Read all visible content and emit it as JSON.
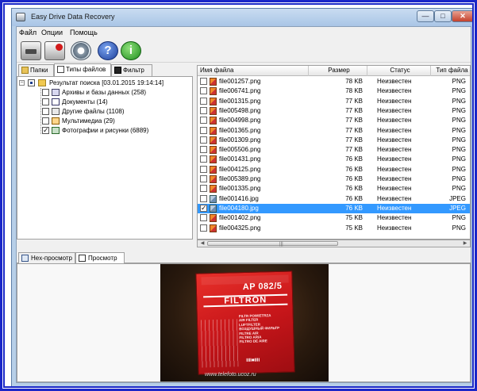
{
  "window": {
    "title": "Easy Drive Data Recovery",
    "min": "—",
    "max": "□",
    "close": "✕"
  },
  "menu": [
    "Файл",
    "Опции",
    "Помощь"
  ],
  "toolbar": {
    "help_glyph": "?",
    "info_glyph": "i",
    "icons": [
      "drive-scan-icon",
      "save-recover-icon",
      "settings-gear-icon",
      "help-icon",
      "info-icon"
    ]
  },
  "left_tabs": [
    "Папки",
    "Типы файлов",
    "Фильтр"
  ],
  "tree": {
    "root": "Результат поиска [03.01.2015 19:14:14]",
    "children": [
      "Архивы и базы данных (258)",
      "Документы (14)",
      "Другие файлы (1108)",
      "Мультимедиа (29)",
      "Фотографии и рисунки (6889)"
    ]
  },
  "file_list": {
    "columns": [
      "Имя файла",
      "Размер",
      "Статус",
      "Тип файла"
    ],
    "rows": [
      {
        "name": "file001257.png",
        "size": "78 KB",
        "status": "Неизвестен",
        "type": "PNG",
        "selected": false
      },
      {
        "name": "file006741.png",
        "size": "78 KB",
        "status": "Неизвестен",
        "type": "PNG",
        "selected": false
      },
      {
        "name": "file001315.png",
        "size": "77 KB",
        "status": "Неизвестен",
        "type": "PNG",
        "selected": false
      },
      {
        "name": "file005498.png",
        "size": "77 KB",
        "status": "Неизвестен",
        "type": "PNG",
        "selected": false
      },
      {
        "name": "file004998.png",
        "size": "77 KB",
        "status": "Неизвестен",
        "type": "PNG",
        "selected": false
      },
      {
        "name": "file001365.png",
        "size": "77 KB",
        "status": "Неизвестен",
        "type": "PNG",
        "selected": false
      },
      {
        "name": "file001309.png",
        "size": "77 KB",
        "status": "Неизвестен",
        "type": "PNG",
        "selected": false
      },
      {
        "name": "file005506.png",
        "size": "77 KB",
        "status": "Неизвестен",
        "type": "PNG",
        "selected": false
      },
      {
        "name": "file001431.png",
        "size": "76 KB",
        "status": "Неизвестен",
        "type": "PNG",
        "selected": false
      },
      {
        "name": "file004125.png",
        "size": "76 KB",
        "status": "Неизвестен",
        "type": "PNG",
        "selected": false
      },
      {
        "name": "file005389.png",
        "size": "76 KB",
        "status": "Неизвестен",
        "type": "PNG",
        "selected": false
      },
      {
        "name": "file001335.png",
        "size": "76 KB",
        "status": "Неизвестен",
        "type": "PNG",
        "selected": false
      },
      {
        "name": "file001416.jpg",
        "size": "76 KB",
        "status": "Неизвестен",
        "type": "JPEG",
        "selected": false
      },
      {
        "name": "file004180.jpg",
        "size": "76 KB",
        "status": "Неизвестен",
        "type": "JPEG",
        "selected": true
      },
      {
        "name": "file001402.png",
        "size": "75 KB",
        "status": "Неизвестен",
        "type": "PNG",
        "selected": false
      },
      {
        "name": "file004325.png",
        "size": "75 KB",
        "status": "Неизвестен",
        "type": "PNG",
        "selected": false
      }
    ]
  },
  "scrollbar": {
    "left": "◀",
    "right": "▶",
    "grip": "|||"
  },
  "bottom_tabs": [
    "Hex-просмотр",
    "Просмотр"
  ],
  "preview": {
    "box_code": "AP 082/5",
    "box_brand": "FILTRON",
    "box_lines": [
      "FILTR POWIETRZA",
      "AIR FILTER",
      "LUFTFILTER",
      "ВОЗДУШНЫЙ ФИЛЬТР",
      "FILTRE AIR",
      "FILTRO ARIA",
      "FILTRO DE AIRE"
    ],
    "box_logo": "IIII■IIII",
    "watermark": "www.telefoto.ucoz.ru"
  },
  "colors": {
    "frame": "#1a27c8",
    "selection": "#3399ff",
    "box_red": "#c8161a"
  }
}
